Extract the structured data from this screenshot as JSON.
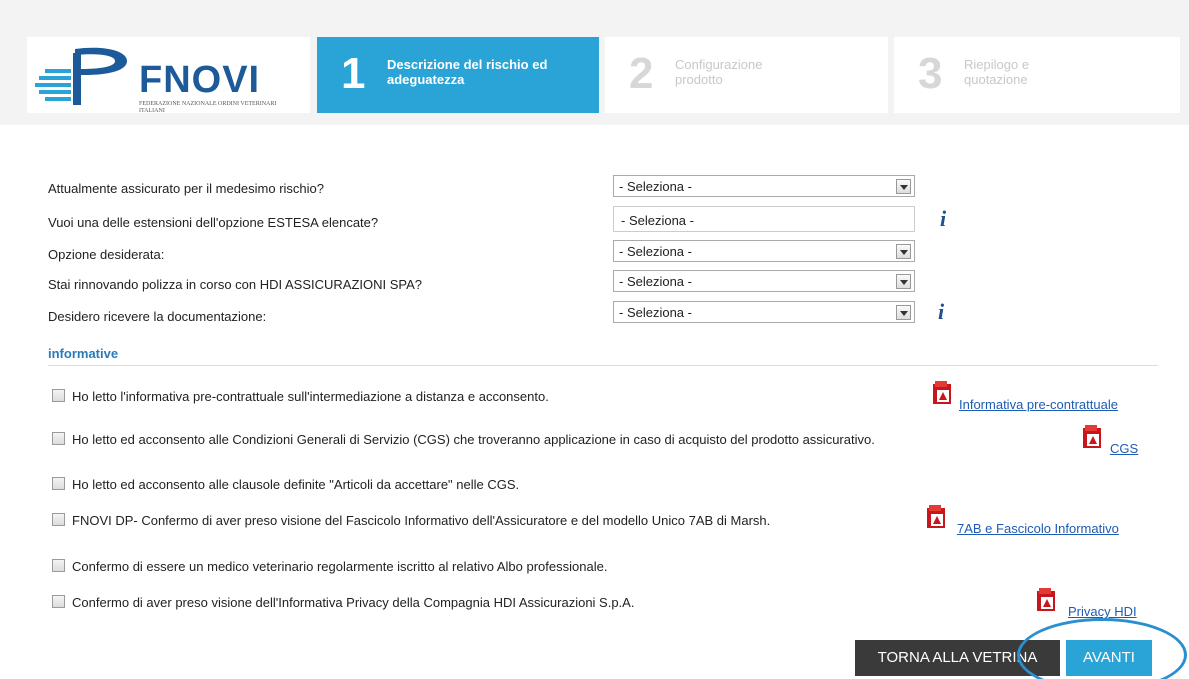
{
  "logo": {
    "name": "FNOVI",
    "subtitle": "FEDERAZIONE NAZIONALE ORDINI VETERINARI ITALIANI"
  },
  "steps": [
    {
      "number": "1",
      "label": "Descrizione del rischio ed adeguatezza"
    },
    {
      "number": "2",
      "label": "Configurazione prodotto"
    },
    {
      "number": "3",
      "label": "Riepilogo e quotazione"
    }
  ],
  "form": {
    "questions": [
      {
        "label": "Attualmente assicurato per il medesimo rischio?",
        "value": "- Seleziona -"
      },
      {
        "label": "Vuoi una delle estensioni dell'opzione ESTESA elencate?",
        "value": "- Seleziona -"
      },
      {
        "label": "Opzione desiderata:",
        "value": "- Seleziona -"
      },
      {
        "label": "Stai rinnovando polizza in corso con HDI ASSICURAZIONI SPA?",
        "value": "- Seleziona -"
      },
      {
        "label": "Desidero ricevere la documentazione:",
        "value": "- Seleziona -"
      }
    ],
    "info_glyph": "i"
  },
  "informative": {
    "title": "informative",
    "items": [
      {
        "text": "Ho letto l'informativa pre-contrattuale sull'intermediazione a distanza e acconsento.",
        "doc": "Informativa pre-contrattuale"
      },
      {
        "text": "Ho letto ed acconsento alle Condizioni Generali di Servizio (CGS) che troveranno applicazione in caso di acquisto del prodotto assicurativo.",
        "doc": "CGS"
      },
      {
        "text": "Ho letto ed acconsento alle clausole definite \"Articoli da accettare\" nelle CGS.",
        "doc": ""
      },
      {
        "text": "FNOVI DP- Confermo di aver preso visione del Fascicolo Informativo dell'Assicuratore e del modello Unico 7AB di Marsh.",
        "doc": "7AB e Fascicolo Informativo"
      },
      {
        "text": "Confermo di essere un medico veterinario regolarmente iscritto al relativo Albo professionale.",
        "doc": ""
      },
      {
        "text": "Confermo di aver preso visione dell'Informativa Privacy della Compagnia HDI Assicurazioni S.p.A.",
        "doc": "Privacy HDI"
      }
    ],
    "icon": "pdf-icon"
  },
  "buttons": {
    "back": "TORNA ALLA VETRINA",
    "next": "AVANTI"
  },
  "colors": {
    "accent": "#2aa3d6",
    "brand": "#1d5a9a",
    "link": "#1d5bb5",
    "dark_button": "#3a3a3a"
  }
}
